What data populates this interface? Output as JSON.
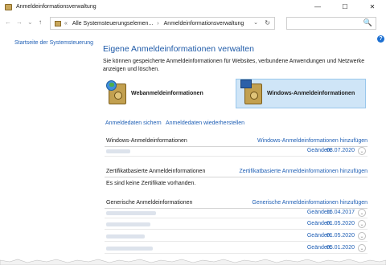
{
  "window": {
    "title": "Anmeldeinformationsverwaltung",
    "controls": {
      "minimize": "—",
      "maximize": "☐",
      "close": "✕"
    }
  },
  "addressbar": {
    "back": "←",
    "forward": "→",
    "dropdown": "⌄",
    "up": "↑",
    "breadcrumb_prefix": "«",
    "crumbs": [
      "Alle Systemsteuerungselemen...",
      "Anmeldeinformationsverwaltung"
    ],
    "crumb_sep": "›",
    "refresh": "↻",
    "search_placeholder": "",
    "search_icon": "🔍"
  },
  "help": {
    "label": "?"
  },
  "sidebar": {
    "home_link": "Startseite der Systemsteuerung"
  },
  "main": {
    "heading": "Eigene Anmeldeinformationen verwalten",
    "description": "Sie können gespeicherte Anmeldeinformationen für Websites, verbundene Anwendungen und Netzwerke anzeigen und löschen.",
    "tiles": [
      {
        "label": "Webanmeldeinformationen",
        "icon": "web-credentials-icon",
        "selected": false
      },
      {
        "label": "Windows-Anmeldeinformationen",
        "icon": "windows-credentials-icon",
        "selected": true
      }
    ],
    "actions": {
      "backup": "Anmeldedaten sichern",
      "restore": "Anmeldedaten wiederherstellen"
    },
    "sections": [
      {
        "title": "Windows-Anmeldeinformationen",
        "add_link": "Windows-Anmeldeinformationen hinzufügen",
        "entries": [
          {
            "changed_label": "Geändert:",
            "date": "08.07.2020"
          }
        ]
      },
      {
        "title": "Zertifikatbasierte Anmeldeinformationen",
        "add_link": "Zertifikatbasierte Anmeldeinformationen hinzufügen",
        "empty_text": "Es sind keine Zertifikate vorhanden."
      },
      {
        "title": "Generische Anmeldeinformationen",
        "add_link": "Generische Anmeldeinformationen hinzufügen",
        "entries": [
          {
            "changed_label": "Geändert:",
            "date": "16.04.2017"
          },
          {
            "changed_label": "Geändert:",
            "date": "01.05.2020"
          },
          {
            "changed_label": "Geändert:",
            "date": "01.05.2020"
          },
          {
            "changed_label": "Geändert:",
            "date": "05.01.2020"
          }
        ]
      }
    ],
    "expand_icon": "⌄"
  },
  "colors": {
    "link": "#1f5fb5",
    "heading": "#1e5aa8",
    "selected_tile": "#cfe5f7",
    "help": "#1c6fd1"
  }
}
